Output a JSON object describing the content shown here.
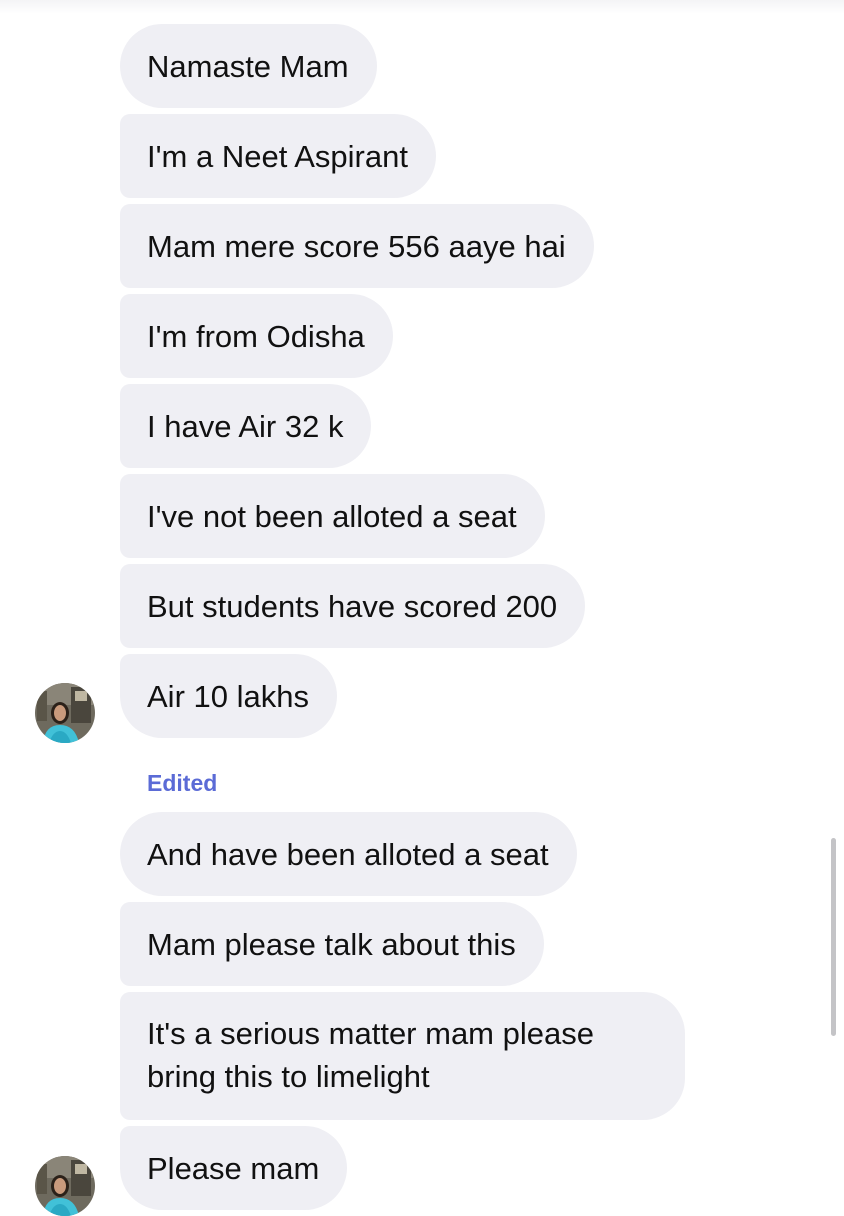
{
  "messages": [
    {
      "text": "Namaste Mam"
    },
    {
      "text": "I'm a Neet Aspirant"
    },
    {
      "text": "Mam mere score 556 aaye hai"
    },
    {
      "text": "I'm from Odisha"
    },
    {
      "text": "I have Air 32 k"
    },
    {
      "text": "I've not been alloted a seat"
    },
    {
      "text": "But students have scored 200"
    },
    {
      "text": "Air 10 lakhs"
    },
    {
      "text": "And have been alloted a seat"
    },
    {
      "text": "Mam please talk about this"
    },
    {
      "text": "It's a serious matter mam please bring this to limelight"
    },
    {
      "text": "Please mam"
    }
  ],
  "edited_label": "Edited",
  "colors": {
    "bubble_background": "#efeff4",
    "edited_label": "#5b6bd6",
    "scrollbar": "#c4c4c7"
  }
}
